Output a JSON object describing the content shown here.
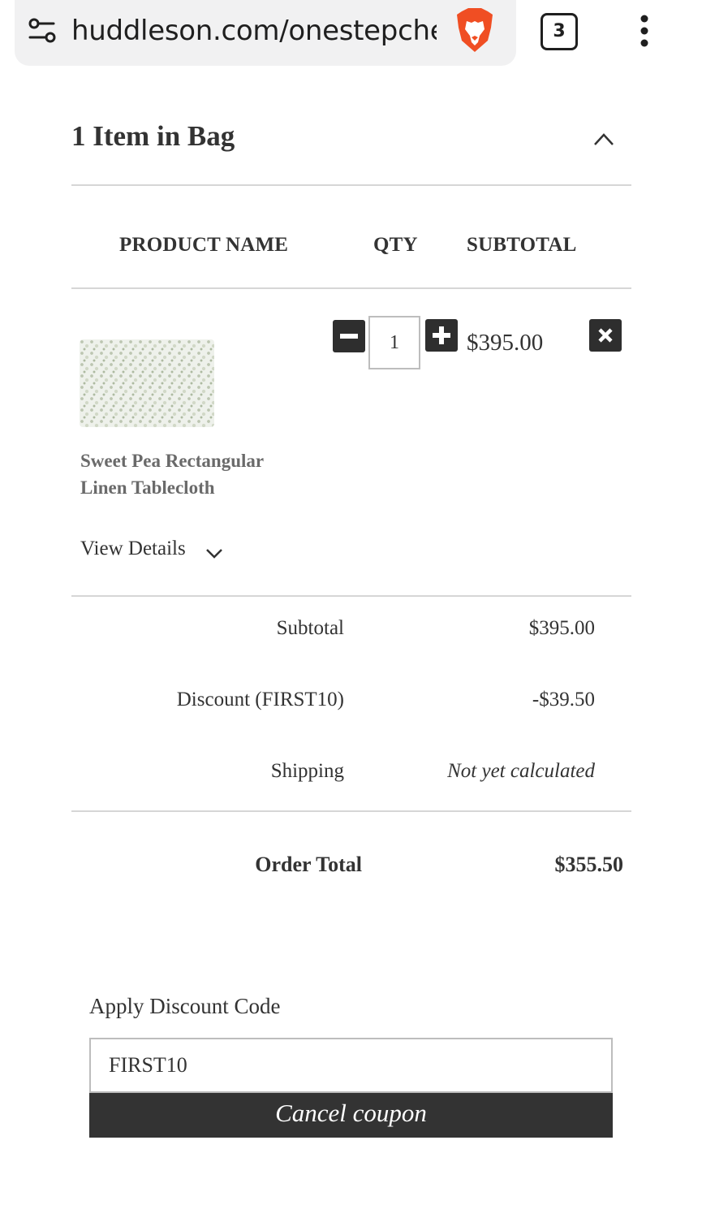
{
  "browser": {
    "url": "huddleson.com/onestepcheckout",
    "tab_count": "3",
    "icons": {
      "site_settings": "tune-icon",
      "shield": "brave-lion-icon",
      "menu": "more-vert-icon"
    }
  },
  "bag": {
    "title": "1 Item in Bag",
    "toggle_icon": "chevron-up-icon"
  },
  "table": {
    "headers": {
      "product": "PRODUCT NAME",
      "qty": "QTY",
      "subtotal": "SUBTOTAL"
    }
  },
  "item": {
    "name": "Sweet Pea Rectangular Linen Tablecloth",
    "quantity": "1",
    "subtotal": "$395.00",
    "view_details": "View Details"
  },
  "totals": {
    "subtotal_label": "Subtotal",
    "subtotal_value": "$395.00",
    "discount_label": "Discount (FIRST10)",
    "discount_value": "-$39.50",
    "shipping_label": "Shipping",
    "shipping_value": "Not yet calculated",
    "order_total_label": "Order Total",
    "order_total_value": "$355.50"
  },
  "discount": {
    "label": "Apply Discount Code",
    "code": "FIRST10",
    "cancel_label": "Cancel coupon"
  },
  "colors": {
    "button_dark": "#333333",
    "divider": "#d6d6d6",
    "brave_orange": "#f04e23"
  }
}
